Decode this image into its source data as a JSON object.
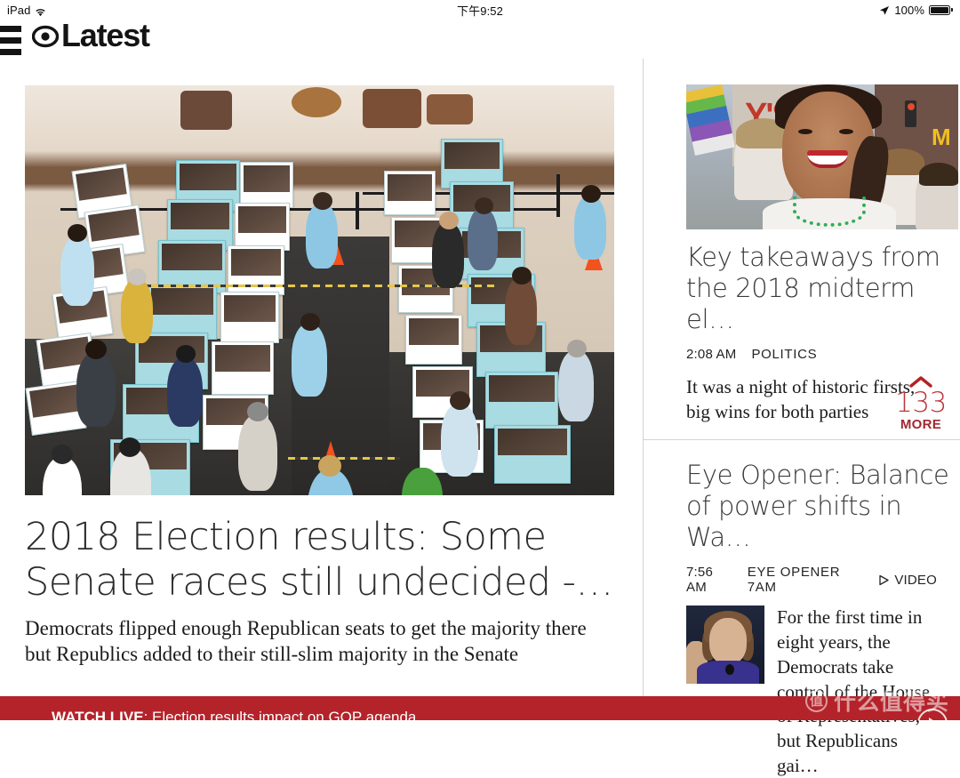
{
  "status_bar": {
    "device": "iPad",
    "wifi_icon": "wifi-icon",
    "time": "下午9:52",
    "location_icon": "location-arrow-icon",
    "battery_percent": "100%",
    "battery_icon": "battery-full-icon"
  },
  "header": {
    "menu_icon": "hamburger-menu-icon",
    "logo_icon": "cbs-eye-icon",
    "brand": "Latest"
  },
  "lead_article": {
    "image_alt": "voters-at-polling-place-photo",
    "title": "2018 Election results: Some Senate races still undecided -…",
    "dek": "Democrats flipped enough Republican seats to get the majority there but Republics added to their still-slim majority in the Senate"
  },
  "sidebar": {
    "articles": [
      {
        "image_alt": "alexandria-ocasio-cortez-parade-photo",
        "title": "Key takeaways from the 2018 midterm el…",
        "time": "2:08 AM",
        "category": "POLITICS",
        "dek": "It was a night of historic firsts, big wins for both parties",
        "more": {
          "chevron_icon": "chevron-up-icon",
          "count": "133",
          "label": "MORE"
        }
      },
      {
        "title": "Eye Opener: Balance of power shifts in Wa…",
        "time": "7:56 AM",
        "category": "EYE OPENER 7AM",
        "video_icon": "play-triangle-icon",
        "video_label": "VIDEO",
        "thumb_alt": "nancy-pelosi-thumbnail",
        "dek": "For the first time in eight years, the Democrats take control of the House of Representatives, but Republicans gai…"
      }
    ]
  },
  "bottom_bar": {
    "kicker": "WATCH LIVE",
    "separator": ": ",
    "headline": "Election results impact on GOP agenda",
    "play_icon": "play-circle-icon",
    "background_color": "#b5232a"
  },
  "watermark": {
    "badge": "值",
    "text": "什么值得买"
  },
  "theme": {
    "accent_red": "#b5232a",
    "more_red": "#b9373c",
    "text_dark": "#2b2b2b",
    "divider": "#d4d4d4"
  }
}
